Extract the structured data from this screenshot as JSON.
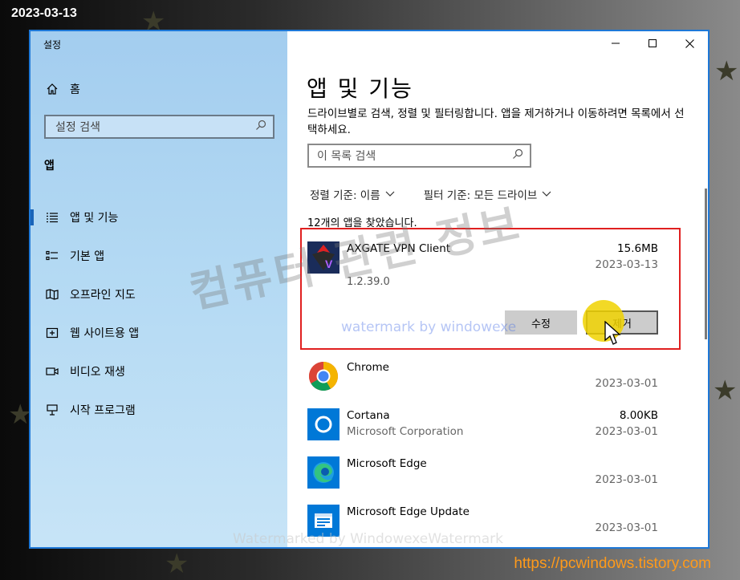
{
  "overlay": {
    "date_stamp": "2023-03-13",
    "url": "https://pcwindows.tistory.com",
    "watermark_ko": "컴퓨터 관련 정보",
    "watermark_en": "watermark by windowexe",
    "watermark_bottom": "Watermarked by WindowexeWatermark"
  },
  "window": {
    "title": "설정"
  },
  "sidebar": {
    "home_label": "홈",
    "search_placeholder": "설정 검색",
    "section_label": "앱",
    "items": [
      {
        "label": "앱 및 기능",
        "icon": "apps-features-icon",
        "active": true
      },
      {
        "label": "기본 앱",
        "icon": "default-apps-icon"
      },
      {
        "label": "오프라인 지도",
        "icon": "offline-maps-icon"
      },
      {
        "label": "웹 사이트용 앱",
        "icon": "apps-for-websites-icon"
      },
      {
        "label": "비디오 재생",
        "icon": "video-playback-icon"
      },
      {
        "label": "시작 프로그램",
        "icon": "startup-icon"
      }
    ]
  },
  "main": {
    "title": "앱 및 기능",
    "description": "드라이브별로 검색, 정렬 및 필터링합니다. 앱을 제거하거나 이동하려면 목록에서 선택하세요.",
    "search_placeholder": "이 목록 검색",
    "sort_label": "정렬 기준: 이름",
    "filter_label": "필터 기준: 모든 드라이브",
    "found_count": "12개의 앱을 찾았습니다.",
    "apps": [
      {
        "name": "AXGATE VPN Client",
        "publisher": "",
        "size": "15.6MB",
        "date": "2023-03-13",
        "version": "1.2.39.0",
        "modify_label": "수정",
        "remove_label": "제거",
        "icon": "axgate-vpn-icon"
      },
      {
        "name": "Chrome",
        "publisher": "",
        "size": "",
        "date": "2023-03-01",
        "icon": "chrome-icon"
      },
      {
        "name": "Cortana",
        "publisher": "Microsoft Corporation",
        "size": "8.00KB",
        "date": "2023-03-01",
        "icon": "cortana-icon"
      },
      {
        "name": "Microsoft Edge",
        "publisher": "",
        "size": "",
        "date": "2023-03-01",
        "icon": "edge-icon"
      },
      {
        "name": "Microsoft Edge Update",
        "publisher": "",
        "size": "",
        "date": "2023-03-01",
        "icon": "edge-update-icon"
      }
    ]
  },
  "colors": {
    "accent": "#1e78d7",
    "highlight_box": "#e02020",
    "cursor_highlight": "#f0d200",
    "sidebar": "#b3d9f3"
  }
}
